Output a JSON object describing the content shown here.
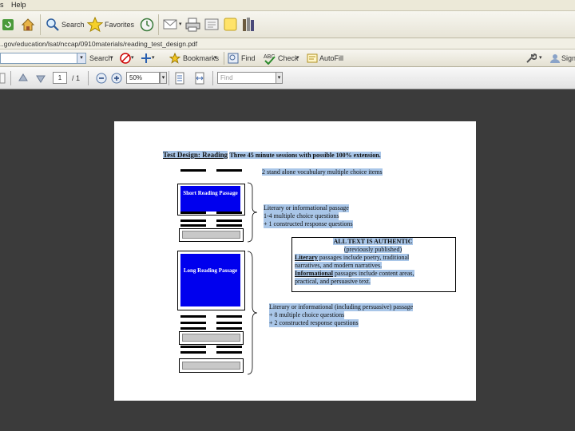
{
  "menu": {
    "items": [
      "s",
      "Help"
    ]
  },
  "toolbar": {
    "search_label": "Search",
    "favorites_label": "Favorites"
  },
  "address": {
    "url": "..gov/education/lsat/nccap/0910materials/reading_test_design.pdf"
  },
  "links_bar": {
    "search_label": "Search",
    "bookmarks_label": "Bookmarks",
    "find_label": "Find",
    "check_label": "Check",
    "autofill_label": "AutoFill",
    "sign_label": "Sign"
  },
  "pdf_toolbar": {
    "page_current": "1",
    "page_total": "/ 1",
    "zoom": "50%",
    "find_placeholder": "Find"
  },
  "document": {
    "title": "Test Design: Reading",
    "title_rest": "Three 45 minute sessions with possible 100% extension.",
    "vocab_line": "2 stand alone vocabulary multiple choice items",
    "short_box": "Short Reading Passage",
    "short_desc": [
      "Literary or informational passage",
      "1-4 multiple choice questions",
      "+ 1 constructed response questions"
    ],
    "authentic_title": "ALL TEXT IS AUTHENTIC",
    "authentic_sub": "(previously published)",
    "literary_word": "Literary",
    "literary_rest": "passages include poetry, traditional",
    "literary_line2": "narratives, and modern narratives.",
    "informational_word": "Informational",
    "informational_rest": "passages include content areas,",
    "informational_line2": "practical, and persuasive text.",
    "long_box": "Long Reading Passage",
    "long_desc": [
      "Literary or informational (including persuasive) passage",
      "+ 8 multiple choice questions",
      "+ 2 constructed response questions"
    ]
  }
}
